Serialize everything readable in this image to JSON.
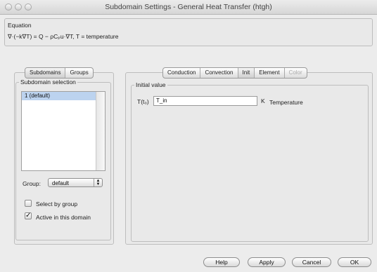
{
  "window": {
    "title": "Subdomain Settings - General Heat Transfer (htgh)"
  },
  "equation": {
    "label": "Equation",
    "text": "∇·(−k∇T) = Q − ρCₚu·∇T, T = temperature"
  },
  "left_tabs": [
    {
      "label": "Subdomains",
      "selected": true
    },
    {
      "label": "Groups",
      "selected": false
    }
  ],
  "subdomain_selection": {
    "label": "Subdomain selection",
    "items": [
      {
        "label": "1 (default)",
        "selected": true
      }
    ]
  },
  "group": {
    "label": "Group:",
    "value": "default"
  },
  "select_by_group": {
    "label": "Select by group",
    "checked": false
  },
  "active_in_domain": {
    "label": "Active in this domain",
    "checked": true
  },
  "right_tabs": [
    {
      "label": "Conduction",
      "state": "normal"
    },
    {
      "label": "Convection",
      "state": "normal"
    },
    {
      "label": "Init",
      "state": "selected"
    },
    {
      "label": "Element",
      "state": "normal"
    },
    {
      "label": "Color",
      "state": "disabled"
    }
  ],
  "initial_value": {
    "label": "Initial value",
    "field_label": "T(t₀)",
    "value": "T_in",
    "unit": "K",
    "description": "Temperature"
  },
  "buttons": {
    "help": "Help",
    "apply": "Apply",
    "cancel": "Cancel",
    "ok": "OK"
  }
}
